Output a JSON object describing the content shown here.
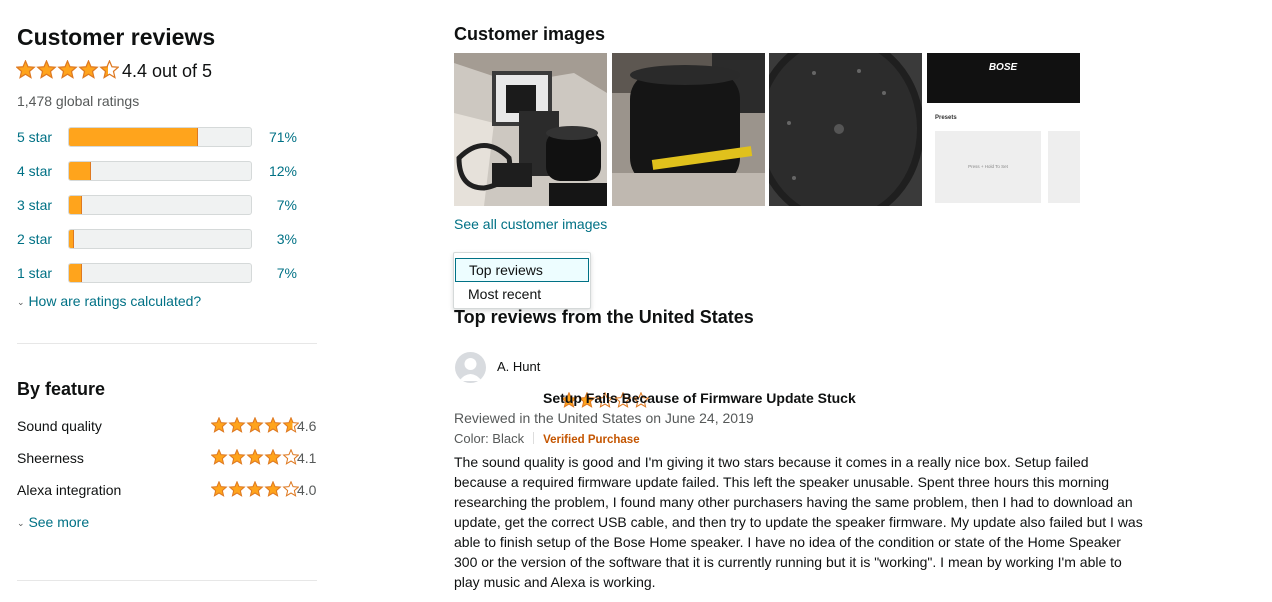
{
  "summary": {
    "title": "Customer reviews",
    "average_text": "4.4 out of 5",
    "average_rating": 4.4,
    "global_ratings": "1,478 global ratings",
    "histogram": [
      {
        "label": "5 star",
        "pct_text": "71%",
        "pct": 71
      },
      {
        "label": "4 star",
        "pct_text": "12%",
        "pct": 12
      },
      {
        "label": "3 star",
        "pct_text": "7%",
        "pct": 7
      },
      {
        "label": "2 star",
        "pct_text": "3%",
        "pct": 3
      },
      {
        "label": "1 star",
        "pct_text": "7%",
        "pct": 7
      }
    ],
    "how_calculated": "How are ratings calculated?"
  },
  "by_feature": {
    "title": "By feature",
    "items": [
      {
        "name": "Sound quality",
        "value_text": "4.6",
        "rating": 4.6
      },
      {
        "name": "Sheerness",
        "value_text": "4.1",
        "rating": 4.1
      },
      {
        "name": "Alexa integration",
        "value_text": "4.0",
        "rating": 4.0
      }
    ],
    "see_more": "See more"
  },
  "customer_images": {
    "title": "Customer images",
    "see_all": "See all customer images",
    "thumbs": [
      {
        "alt": "unboxed speaker with accessories",
        "icon": "photo-icon"
      },
      {
        "alt": "speaker with tape measure",
        "icon": "photo-icon"
      },
      {
        "alt": "speaker top view",
        "icon": "photo-icon"
      },
      {
        "alt": "app presets screen",
        "brand": "BOSE",
        "section": "Presets",
        "preset_btn": "Press + Hold To Set",
        "icon": "photo-icon"
      }
    ]
  },
  "sort_menu": {
    "options": [
      "Top reviews",
      "Most recent"
    ],
    "selected": "Top reviews"
  },
  "top_reviews": {
    "title": "Top reviews from the United States"
  },
  "review": {
    "reviewer": "A. Hunt",
    "rating": 2,
    "title": "Setup Fails Because of Firmware Update Stuck",
    "date": "Reviewed in the United States on June 24, 2019",
    "color": "Color: Black",
    "verified": "Verified Purchase",
    "body": "The sound quality is good and I'm giving it two stars because it comes in a really nice box. Setup failed because a required firmware update failed. This left the speaker unusable. Spent three hours this morning researching the problem, I found many other purchasers having the same problem, then I had to download an update, get the correct USB cable, and then try to update the speaker firmware. My update also failed but I was able to finish setup of the Bose Home speaker. I have no idea of the condition or state of the Home Speaker 300 or the version of the software that it is currently running but it is \"working\". I mean by working I'm able to play music and Alexa is working."
  },
  "colors": {
    "star": "#ffa41c",
    "star_stroke": "#de7921",
    "link": "#007185",
    "verified": "#c45500"
  }
}
